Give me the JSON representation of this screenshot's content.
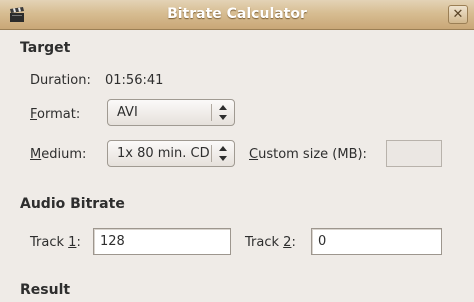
{
  "window": {
    "title": "Bitrate Calculator",
    "close_glyph": "✕",
    "icon": "clapperboard-icon"
  },
  "target": {
    "heading": "Target",
    "duration_label": "Duration:",
    "duration_value": "01:56:41",
    "format_label_pre": "",
    "format_label_mnemonic": "F",
    "format_label_post": "ormat:",
    "format_value": "AVI",
    "medium_label_pre": "",
    "medium_label_mnemonic": "M",
    "medium_label_post": "edium:",
    "medium_value": "1x 80 min. CD",
    "custom_size_label_pre": "",
    "custom_size_label_mnemonic": "C",
    "custom_size_label_post": "ustom size (MB):",
    "custom_size_value": ""
  },
  "audio": {
    "heading": "Audio Bitrate",
    "track1_label_pre": "Track ",
    "track1_label_mnemonic": "1",
    "track1_label_post": ":",
    "track1_value": "128",
    "track2_label_pre": "Track ",
    "track2_label_mnemonic": "2",
    "track2_label_post": ":",
    "track2_value": "0"
  },
  "result": {
    "heading": "Result"
  }
}
